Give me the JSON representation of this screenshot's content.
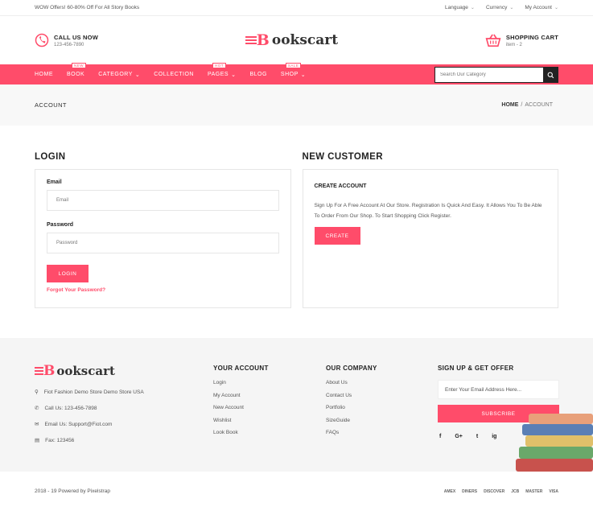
{
  "topbar": {
    "offer": "WOW Offers! 60-80% Off For All Story Books",
    "language": "Language",
    "currency": "Currency",
    "account": "My Account"
  },
  "header": {
    "call_title": "CALL US NOW",
    "call_number": "123-456-7890",
    "logo_text": "ookscart",
    "cart_title": "SHOPPING CART",
    "cart_items": "item - 2"
  },
  "nav": {
    "items": [
      {
        "label": "HOME"
      },
      {
        "label": "BOOK",
        "badge": "NEW"
      },
      {
        "label": "CATEGORY"
      },
      {
        "label": "COLLECTION"
      },
      {
        "label": "PAGES",
        "badge": "HOT"
      },
      {
        "label": "BLOG"
      },
      {
        "label": "SHOP",
        "badge": "SALE"
      }
    ],
    "search_placeholder": "Search Our Category"
  },
  "breadcrumb": {
    "title": "ACCOUNT",
    "home": "HOME",
    "separator": "/",
    "current": "ACCOUNT"
  },
  "login": {
    "title": "LOGIN",
    "email_label": "Email",
    "email_placeholder": "Email",
    "password_label": "Password",
    "password_placeholder": "Password",
    "button": "LOGIN",
    "forgot": "Forgot Your Password?"
  },
  "new_customer": {
    "title": "NEW CUSTOMER",
    "subtitle": "CREATE ACCOUNT",
    "text": "Sign Up For A Free Account At Our Store. Registration Is Quick And Easy. It Allows You To Be Able To Order From Our Shop. To Start Shopping Click Register.",
    "button": "CREATE"
  },
  "footer": {
    "logo_text": "ookscart",
    "address": "Fiot Fashion Demo Store Demo Store USA",
    "call": "Call Us: 123-456-7898",
    "email": "Email Us: Support@Fiot.com",
    "fax": "Fax: 123456",
    "your_account": {
      "title": "YOUR ACCOUNT",
      "links": [
        "Login",
        "My Account",
        "New Account",
        "Wishlist",
        "Look Book"
      ]
    },
    "our_company": {
      "title": "OUR COMPANY",
      "links": [
        "About Us",
        "Contact Us",
        "Portfolio",
        "SizeGuide",
        "FAQs"
      ]
    },
    "signup": {
      "title": "SIGN UP & GET OFFER",
      "placeholder": "Enter Your Email Address Here...",
      "button": "SUBSCRIBE",
      "socials": [
        "f",
        "G+",
        "t",
        "ig"
      ]
    }
  },
  "bottom": {
    "copyright": "2018 - 19 Powered by Pixelstrap",
    "payments": [
      "AMEX",
      "DINERS",
      "DISCOVER",
      "JCB",
      "MASTER",
      "VISA"
    ]
  },
  "colors": {
    "accent": "#ff4c6a",
    "dark": "#222222"
  }
}
